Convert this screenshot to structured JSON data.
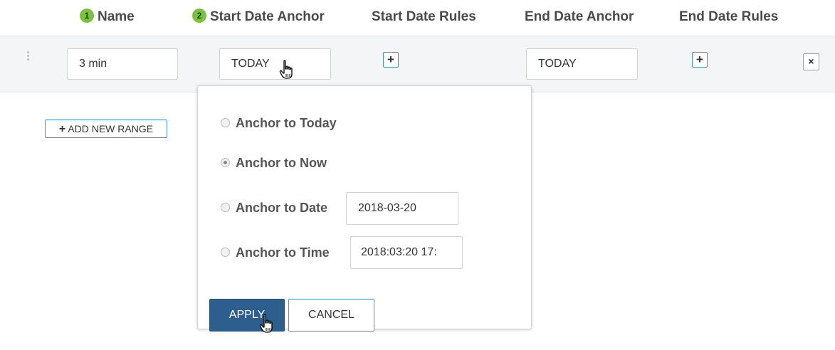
{
  "columns": {
    "name": {
      "badge": "1",
      "label": "Name"
    },
    "start_anchor": {
      "badge": "2",
      "label": "Start Date Anchor"
    },
    "start_rules": {
      "label": "Start Date Rules"
    },
    "end_anchor": {
      "label": "End Date Anchor"
    },
    "end_rules": {
      "label": "End Date Rules"
    }
  },
  "row": {
    "name_value": "3 min",
    "start_anchor_value": "TODAY",
    "end_anchor_value": "TODAY",
    "add_rule_symbol": "+",
    "remove_symbol": "×"
  },
  "add_range": {
    "symbol": "+",
    "label": "ADD NEW RANGE"
  },
  "popover": {
    "options": [
      {
        "label": "Anchor to Today",
        "selected": false
      },
      {
        "label": "Anchor to Now",
        "selected": true
      },
      {
        "label": "Anchor to Date",
        "selected": false,
        "input_value": "2018-03-20"
      },
      {
        "label": "Anchor to Time",
        "selected": false,
        "input_value": "2018:03:20 17:"
      }
    ],
    "apply_label": "APPLY",
    "cancel_label": "CANCEL"
  },
  "colors": {
    "badge": "#7ac142",
    "accent_border": "#4a90c2",
    "primary_button": "#2d5f8e",
    "row_background": "#f4f5f6"
  },
  "icons": {
    "cursor": "hand-pointer-icon",
    "drag": "drag-handle-icon",
    "plus": "plus-icon",
    "close": "close-icon"
  }
}
